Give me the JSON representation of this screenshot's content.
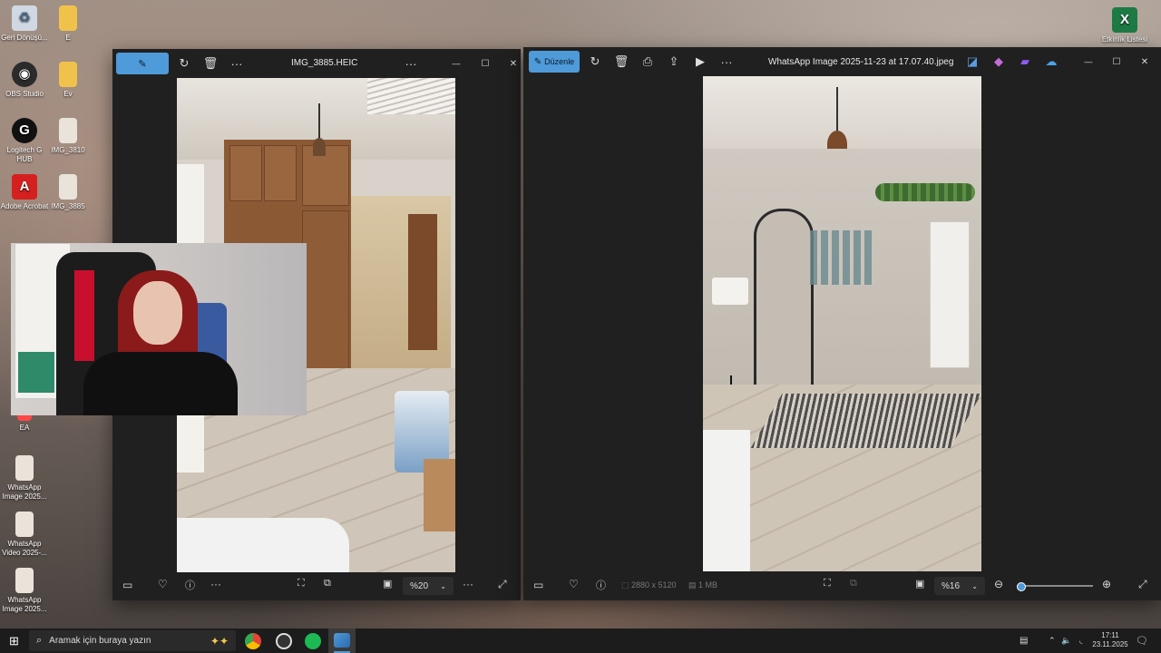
{
  "desktop": {
    "icons": [
      {
        "label": "Geri Dönüşü...",
        "icon": "recycle-bin-icon",
        "color": "#cfd8e3",
        "glyph": "♻"
      },
      {
        "label": "OBS Studio",
        "icon": "obs-icon",
        "color": "#2b2b2b",
        "glyph": "◉"
      },
      {
        "label": "Logitech G HUB",
        "icon": "logitech-icon",
        "color": "#111111",
        "glyph": "G"
      },
      {
        "label": "Adobe Acrobat",
        "icon": "acrobat-icon",
        "color": "#d6201f",
        "glyph": "A"
      },
      {
        "label": "EA",
        "icon": "ea-icon",
        "color": "#ff4747",
        "glyph": "EA"
      },
      {
        "label": "WhatsApp Image 2025...",
        "icon": "image-file-icon",
        "color": "#e9e3da",
        "glyph": "▯"
      },
      {
        "label": "WhatsApp Video 2025-...",
        "icon": "video-file-icon",
        "color": "#e9e3da",
        "glyph": "▯"
      },
      {
        "label": "WhatsApp Image 2025...",
        "icon": "image-file-icon",
        "color": "#e9e3da",
        "glyph": "▯"
      },
      {
        "label": "E",
        "icon": "folder-icon",
        "color": "#f0c24b",
        "glyph": "▮"
      },
      {
        "label": "Ev",
        "icon": "folder-icon",
        "color": "#f0c24b",
        "glyph": "▮"
      },
      {
        "label": "IMG_3810",
        "icon": "image-file-icon",
        "color": "#e9e3da",
        "glyph": "▯"
      },
      {
        "label": "IMG_3885",
        "icon": "image-file-icon",
        "color": "#e9e3da",
        "glyph": "▯"
      },
      {
        "label": "Etkinlik Listesi",
        "icon": "excel-icon",
        "color": "#1d7a45",
        "glyph": "X"
      }
    ]
  },
  "window_left": {
    "title": "IMG_3885.HEIC",
    "edit_label": "",
    "zoom": "%20",
    "more": "···",
    "minimize": "—",
    "maximize": "☐",
    "close": "✕"
  },
  "window_right": {
    "title": "WhatsApp Image 2025-11-23 at 17.07.40.jpeg",
    "edit_label": "Düzenle",
    "dimensions": "2880 x 5120",
    "size": "1 MB",
    "zoom": "%16",
    "more": "···",
    "minimize": "—",
    "maximize": "☐",
    "close": "✕"
  },
  "taskbar": {
    "search_placeholder": "Aramak için buraya yazın",
    "time": "17:11",
    "date": "23.11.2025"
  },
  "colors": {
    "accent": "#4f9ad8",
    "window_bg": "#202020",
    "taskbar_bg": "#1c1c1c"
  }
}
